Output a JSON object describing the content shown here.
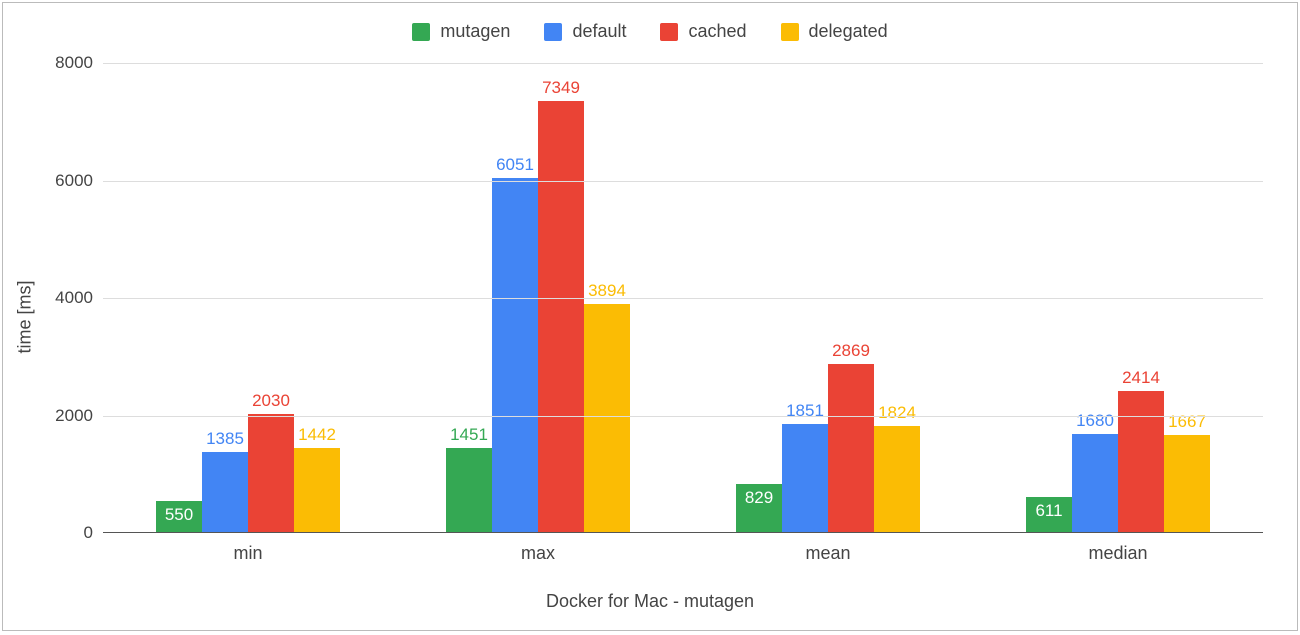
{
  "chart_data": {
    "type": "bar",
    "categories": [
      "min",
      "max",
      "mean",
      "median"
    ],
    "series": [
      {
        "name": "mutagen",
        "color": "#34a853",
        "values": [
          550,
          1451,
          829,
          611
        ]
      },
      {
        "name": "default",
        "color": "#4285f4",
        "values": [
          1385,
          6051,
          1851,
          1680
        ]
      },
      {
        "name": "cached",
        "color": "#ea4335",
        "values": [
          2030,
          7349,
          2869,
          2414
        ]
      },
      {
        "name": "delegated",
        "color": "#fbbc04",
        "values": [
          1442,
          3894,
          1824,
          1667
        ]
      }
    ],
    "title": "",
    "xlabel": "Docker for Mac - mutagen",
    "ylabel": "time [ms]",
    "ylim": [
      0,
      8000
    ],
    "yticks": [
      0,
      2000,
      4000,
      6000,
      8000
    ],
    "label_inside": {
      "mutagen": [
        true,
        false,
        true,
        true
      ]
    }
  }
}
